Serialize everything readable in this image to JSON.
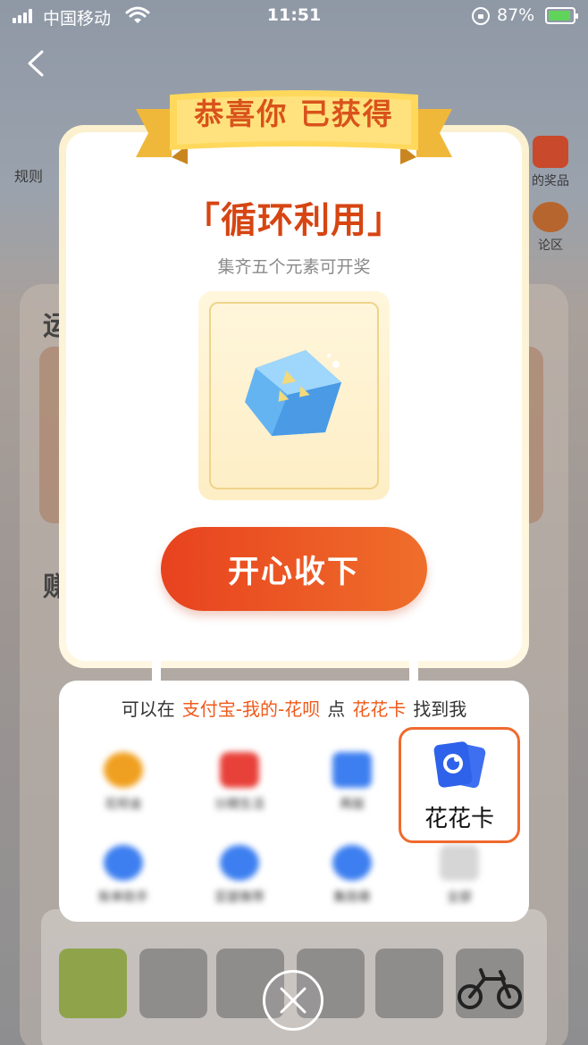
{
  "status_bar": {
    "carrier": "中国移动",
    "time": "11:51",
    "battery_percent": "87%",
    "battery_color": "#5fd35a"
  },
  "background_page": {
    "rules_label": "规则",
    "prize_label": "的奖品",
    "discuss_label": "论区",
    "title_a": "运",
    "title_b": "赚"
  },
  "modal": {
    "ribbon_title": "恭喜你 已获得",
    "reward_name": "「循环利用」",
    "reward_subtitle": "集齐五个元素可开奖",
    "reward_icon": "recycle-cube-icon",
    "accept_label": "开心收下",
    "accent_color": "#e8421f"
  },
  "hint": {
    "prefix": "可以在",
    "path": "支付宝-我的-花呗",
    "middle": "点",
    "target": "花花卡",
    "suffix": "找到我",
    "highlight_color": "#ef5a1a"
  },
  "highlighted_entry": {
    "label": "花花卡",
    "icon": "card-icon"
  },
  "blurred_grid": [
    {
      "label": "花呗金",
      "icon": "coin-icon",
      "color": "#f0a020"
    },
    {
      "label": "分期生活",
      "icon": "installment-icon",
      "color": "#e8413a"
    },
    {
      "label": "再版",
      "icon": "calendar-icon",
      "color": "#3d7ff0"
    },
    {
      "label": "账单助手",
      "icon": "clock-icon",
      "color": "#3d7ff0"
    },
    {
      "label": "亚瑟推荐",
      "icon": "bag-icon",
      "color": "#3d7ff0"
    },
    {
      "label": "集勋章",
      "icon": "medal-icon",
      "color": "#3d7ff0"
    },
    {
      "label": "全部",
      "icon": "grid-icon",
      "color": "#bbbbbb"
    }
  ],
  "close": {
    "icon": "close-icon"
  }
}
